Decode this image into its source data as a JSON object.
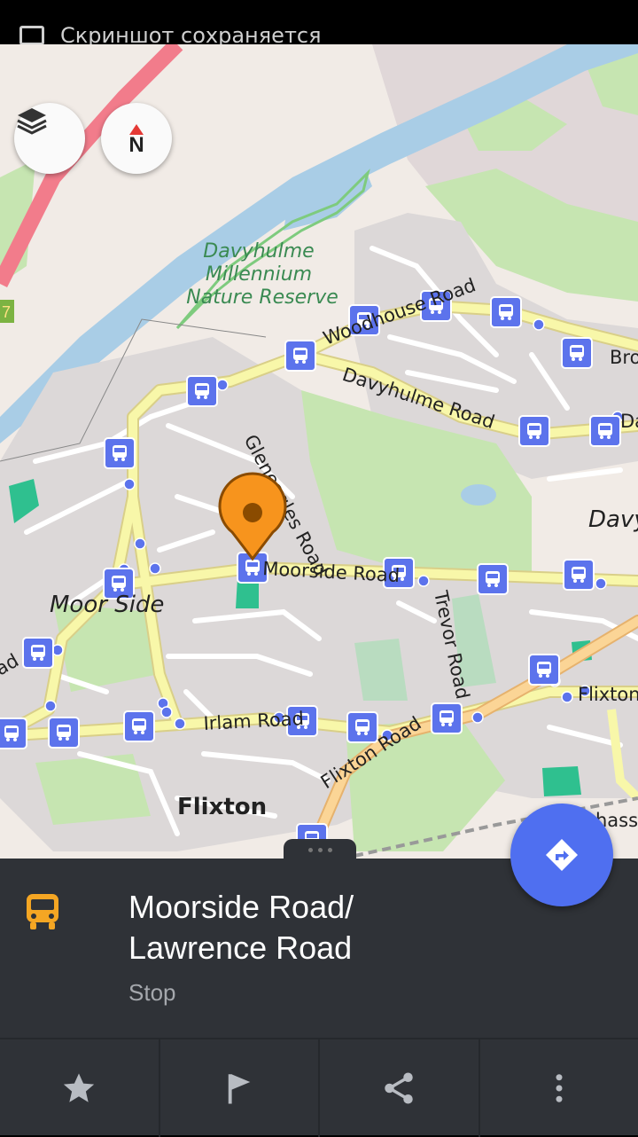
{
  "status_bar": {
    "notification": "Скриншот сохраняется"
  },
  "map": {
    "labels": {
      "nature_reserve": [
        "Davyhulme",
        "Millennium",
        "Nature Reserve"
      ],
      "road_woodhouse": "Woodhouse Road",
      "road_davyhulme": "Davyhulme Road",
      "road_gleneagles": "Gleneagles Road",
      "road_moorside": "Moorside Road",
      "road_trevor": "Trevor Road",
      "road_irlam": "Irlam Road",
      "road_flixton": "Flixton Road",
      "road_flixton_east": "Flixton",
      "road_bro": "Bro",
      "road_dav_right": "Dav",
      "road_ad": "ad",
      "place_moor_side": "Moor Side",
      "place_flixton": "Flixton",
      "place_davy": "Davy",
      "place_hass": "hass",
      "route_number": "7"
    },
    "compass_label": "N",
    "layers_icon": "layers-icon",
    "directions_icon": "directions-icon"
  },
  "poi": {
    "title": "Moorside Road/ Lawrence Road",
    "title_line1": "Moorside Road/",
    "title_line2": "Lawrence Road",
    "type": "Stop",
    "icon": "bus-icon",
    "icon_color": "#f5a623"
  },
  "actions": [
    {
      "icon": "star-icon"
    },
    {
      "icon": "flag-icon"
    },
    {
      "icon": "share-icon"
    },
    {
      "icon": "more-vertical-icon"
    }
  ],
  "colors": {
    "panel_bg": "#2f3237",
    "fab": "#4f6ff0",
    "bus_stop": "#5c73ec",
    "pin": "#f7941d",
    "water": "#a9cde6",
    "park": "#c6e5b1",
    "road_major": "#f8f7a9",
    "motorway": "#f27c8b"
  }
}
